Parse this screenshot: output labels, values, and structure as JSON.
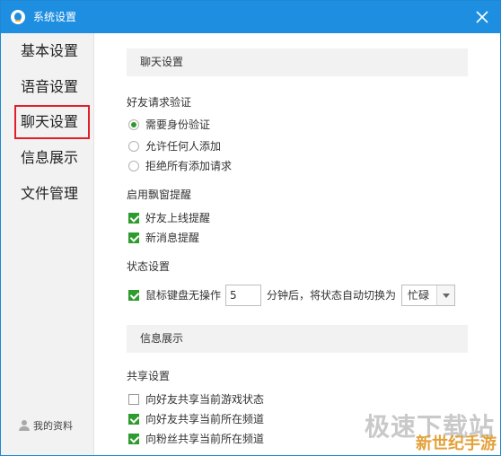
{
  "window": {
    "title": "系统设置",
    "close_icon": "close-icon"
  },
  "sidebar": {
    "items": [
      {
        "label": "基本设置"
      },
      {
        "label": "语音设置"
      },
      {
        "label": "聊天设置"
      },
      {
        "label": "信息展示"
      },
      {
        "label": "文件管理"
      }
    ],
    "selected": "聊天设置",
    "profile_label": "我的资料"
  },
  "chat": {
    "header": "聊天设置",
    "friend_verify": {
      "title": "好友请求验证",
      "options": [
        {
          "label": "需要身份验证",
          "selected": true
        },
        {
          "label": "允许任何人添加",
          "selected": false
        },
        {
          "label": "拒绝所有添加请求",
          "selected": false
        }
      ]
    },
    "popup": {
      "title": "启用飘窗提醒",
      "options": [
        {
          "label": "好友上线提醒",
          "checked": true
        },
        {
          "label": "新消息提醒",
          "checked": true
        }
      ]
    },
    "status": {
      "title": "状态设置",
      "idle_label": "鼠标键盘无操作",
      "idle_checked": true,
      "idle_minutes": "5",
      "after_text": "分钟后，将状态自动切换为",
      "status_value": "忙碌"
    }
  },
  "info": {
    "header": "信息展示",
    "share": {
      "title": "共享设置",
      "options": [
        {
          "label": "向好友共享当前游戏状态",
          "checked": false
        },
        {
          "label": "向好友共享当前所在频道",
          "checked": true
        },
        {
          "label": "向粉丝共享当前所在频道",
          "checked": true
        }
      ]
    }
  },
  "watermark": {
    "line1": "极速下载站",
    "line2": "新世纪手游"
  },
  "colors": {
    "titlebar": "#1e8ee0",
    "selected_border": "#e21e2b",
    "check_green": "#2e9b2e",
    "sidebar_bg": "#f2f2f2"
  }
}
